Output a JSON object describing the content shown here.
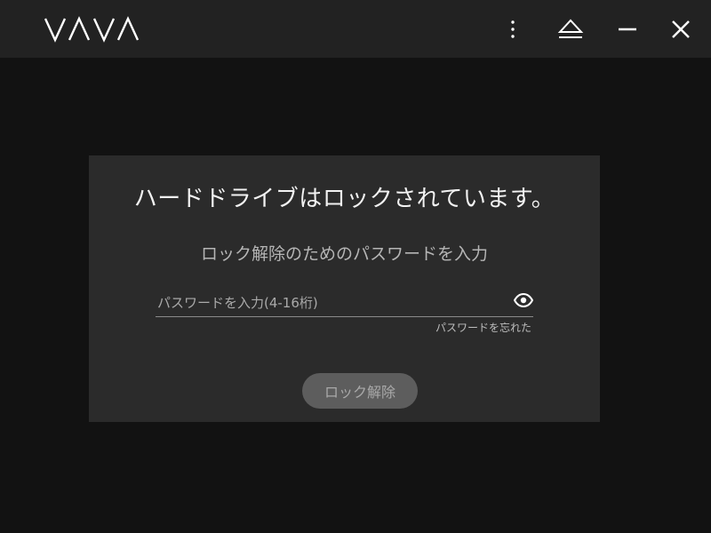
{
  "app": {
    "logo_text": "VAVA",
    "title_buttons": [
      {
        "icon": "more-vertical-icon"
      },
      {
        "icon": "eject-icon"
      },
      {
        "icon": "minimize-icon"
      },
      {
        "icon": "close-icon"
      }
    ]
  },
  "dialog": {
    "title": "ハードドライブはロックされています。",
    "subtitle": "ロック解除のためのパスワードを入力",
    "password": {
      "value": "",
      "placeholder": "パスワードを入力(4-16桁)",
      "toggle_icon": "eye-icon"
    },
    "forgot_label": "パスワードを忘れた",
    "unlock_label": "ロック解除"
  },
  "colors": {
    "background": "#121212",
    "titlebar": "#222222",
    "dialog": "#2b2b2b",
    "button_disabled": "#5d5d5d"
  }
}
